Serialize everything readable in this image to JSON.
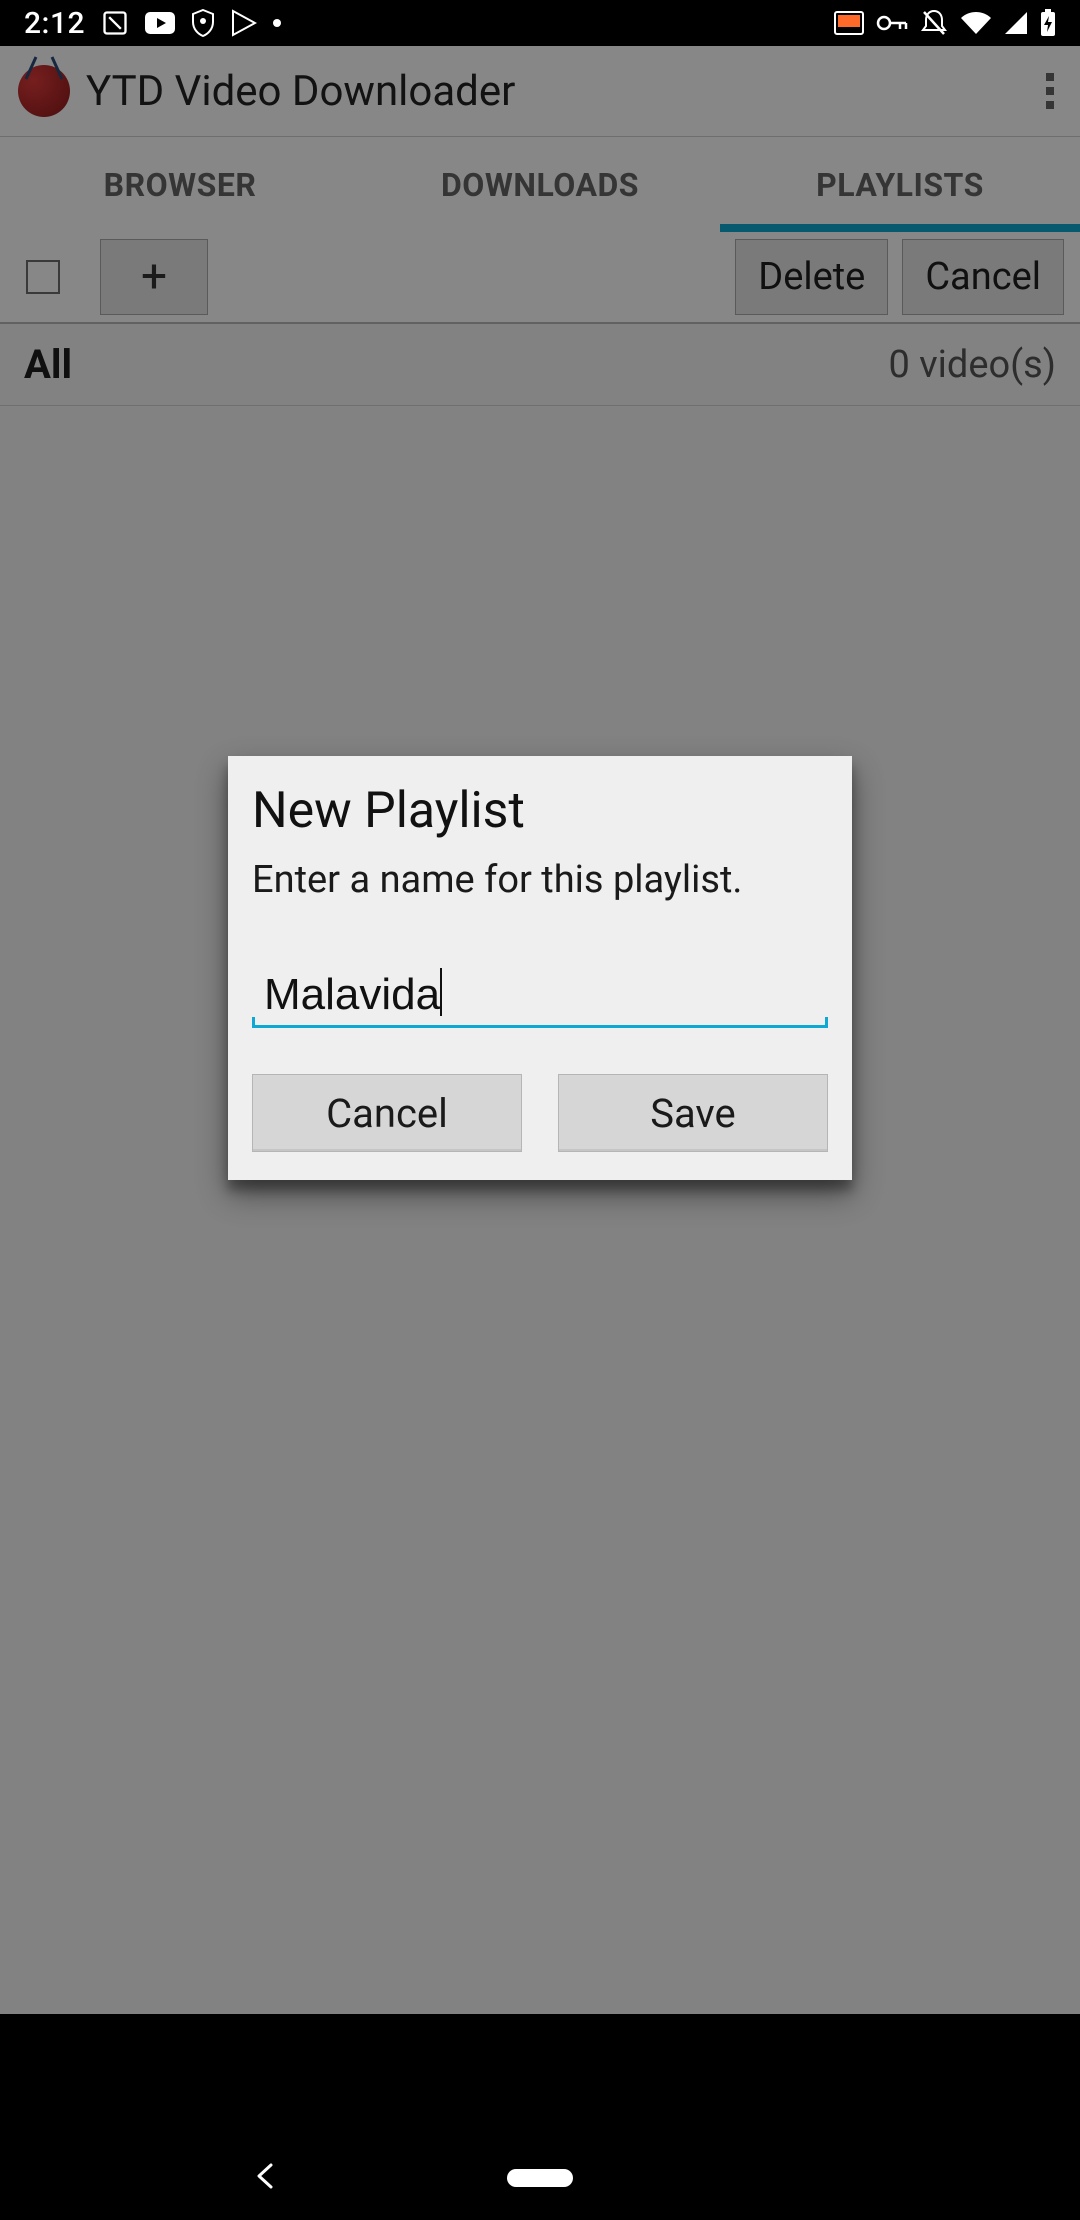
{
  "status": {
    "clock": "2:12",
    "left_icons": [
      "calendar-blocked-icon",
      "youtube-icon",
      "shield-icon",
      "play-store-icon",
      "dot-icon"
    ],
    "right_icons": [
      "cast-icon",
      "key-icon",
      "dnd-off-icon",
      "wifi-icon",
      "cell-signal-icon",
      "battery-charging-icon"
    ]
  },
  "app": {
    "title": "YTD Video Downloader"
  },
  "tabs": {
    "0": {
      "label": "BROWSER"
    },
    "1": {
      "label": "DOWNLOADS"
    },
    "2": {
      "label": "PLAYLISTS"
    }
  },
  "actions": {
    "add": "+",
    "delete": "Delete",
    "cancel": "Cancel"
  },
  "list": {
    "all_label": "All",
    "count": "0 video(s)"
  },
  "dialog": {
    "title": "New Playlist",
    "subtitle": "Enter a name for this playlist.",
    "value": "Malavida",
    "cancel": "Cancel",
    "save": "Save"
  },
  "accent": "#0ea8d4"
}
